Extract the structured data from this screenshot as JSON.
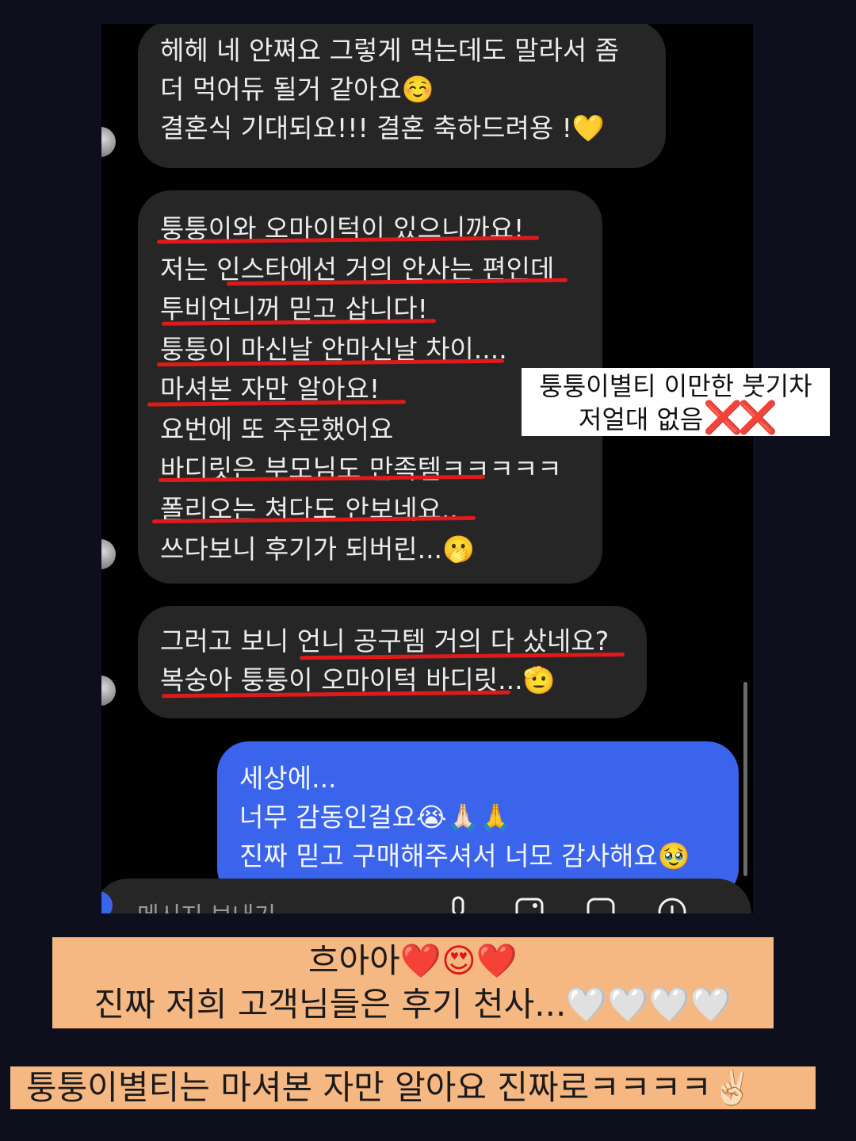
{
  "conversation": {
    "messages": [
      {
        "sender": "customer",
        "lines": [
          "헤헤 네 안쪄요 그렇게 먹는데도 말라서 좀",
          "더 먹어듀 될거 같아요☺️",
          "결혼식 기대되요!!! 결혼 축하드려용 !💛"
        ]
      },
      {
        "sender": "customer",
        "lines": [
          "퉁퉁이와 오마이턱이 있으니까요!",
          "저는 인스타에선 거의 안사는 편인데",
          "투비언니꺼 믿고 삽니다!",
          "퉁퉁이 마신날 안마신날 차이....",
          "마셔본 자만 알아요!",
          "요번에 또 주문했어요",
          "바디릿은 부모님도 만족템ㅋㅋㅋㅋㅋ",
          "폴리오는 쳐다도 안보네요..",
          "쓰다보니 후기가 되버린...🫢"
        ]
      },
      {
        "sender": "customer",
        "lines": [
          "그러고 보니 언니 공구템 거의 다 샀네요?",
          "복숭아 퉁퉁이 오마이턱 바디릿...🫡"
        ]
      },
      {
        "sender": "me",
        "lines": [
          "세상에...",
          "너무 감동인걸요😭🙏🏻🙏",
          "진짜 믿고 구매해주셔서 너모 감사해요🥹"
        ]
      }
    ],
    "composer_placeholder": "메시지 보내기"
  },
  "note_box": {
    "line1": "퉁퉁이별티 이만한 붓기차",
    "line2": "저얼대 없음",
    "x_marks": "❌❌"
  },
  "caption_1": {
    "line1_text": "흐아아",
    "line1_emojis": "❤️😍❤️",
    "line2_text": "진짜 저희 고객님들은 후기 천사...",
    "line2_emojis": "🤍🤍🤍🤍"
  },
  "caption_2": {
    "text": "퉁퉁이별티는 마셔본 자만 알아요 진짜로ㅋㅋㅋㅋ✌🏻"
  },
  "colors": {
    "page_background": "#0d0f1c",
    "incoming_bubble": "#262626",
    "outgoing_bubble": "#3b64ec",
    "underline_marker": "#e01a1a",
    "caption_background": "#f6b883",
    "note_box_background": "#ffffff"
  }
}
